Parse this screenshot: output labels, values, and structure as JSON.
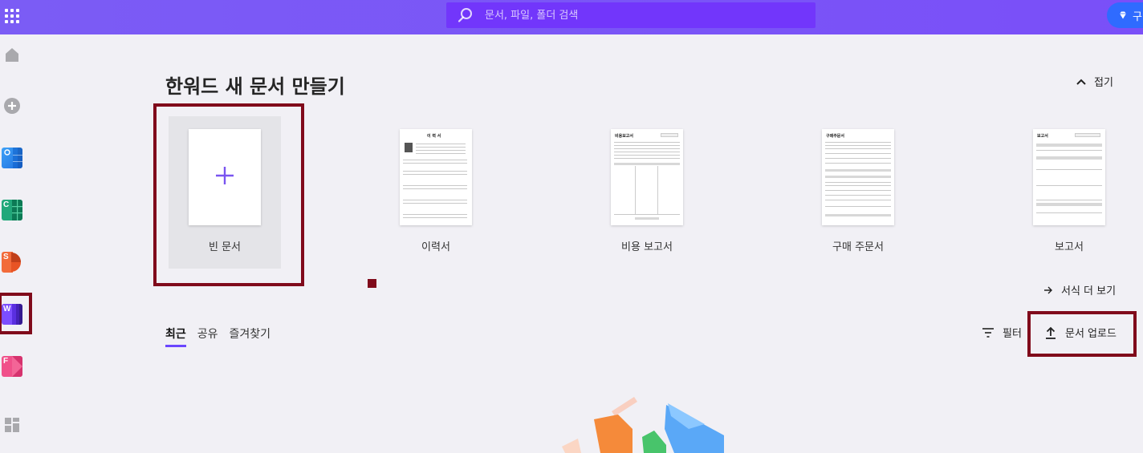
{
  "search": {
    "placeholder": "문서, 파일, 폴더 검색"
  },
  "topbar": {
    "buy_label": "구"
  },
  "main": {
    "title": "한워드 새 문서 만들기",
    "collapse_label": "접기",
    "more_templates_label": "서식 더 보기"
  },
  "templates": [
    {
      "label": "빈 문서"
    },
    {
      "label": "이력서",
      "doc_title": "이 력 서"
    },
    {
      "label": "비용 보고서",
      "doc_title": "비용보고서"
    },
    {
      "label": "구매 주문서",
      "doc_title": "구매주문서"
    },
    {
      "label": "보고서",
      "doc_title": "보고서"
    }
  ],
  "tabs": [
    {
      "label": "최근",
      "active": true
    },
    {
      "label": "공유",
      "active": false
    },
    {
      "label": "즐겨찾기",
      "active": false
    }
  ],
  "toolbar": {
    "filter_label": "필터",
    "upload_label": "문서 업로드"
  },
  "sidebar": {
    "items": [
      {
        "name": "home",
        "icon": "home-icon"
      },
      {
        "name": "new",
        "icon": "plus-circle-icon"
      },
      {
        "name": "calendar-app",
        "icon": "calendar-app-icon"
      },
      {
        "name": "cell-app",
        "icon": "cell-app-icon",
        "letter": "C"
      },
      {
        "name": "show-app",
        "icon": "show-app-icon",
        "letter": "S"
      },
      {
        "name": "word-app",
        "icon": "word-app-icon",
        "letter": "W"
      },
      {
        "name": "form-app",
        "icon": "form-app-icon",
        "letter": "F"
      },
      {
        "name": "more-apps",
        "icon": "grid-icon"
      }
    ]
  },
  "colors": {
    "topbar": "#7b5cf5",
    "search_bg": "#7236fb",
    "accent": "#6b46ff",
    "highlight": "#800a1b",
    "buy_button": "#2f6bff"
  }
}
